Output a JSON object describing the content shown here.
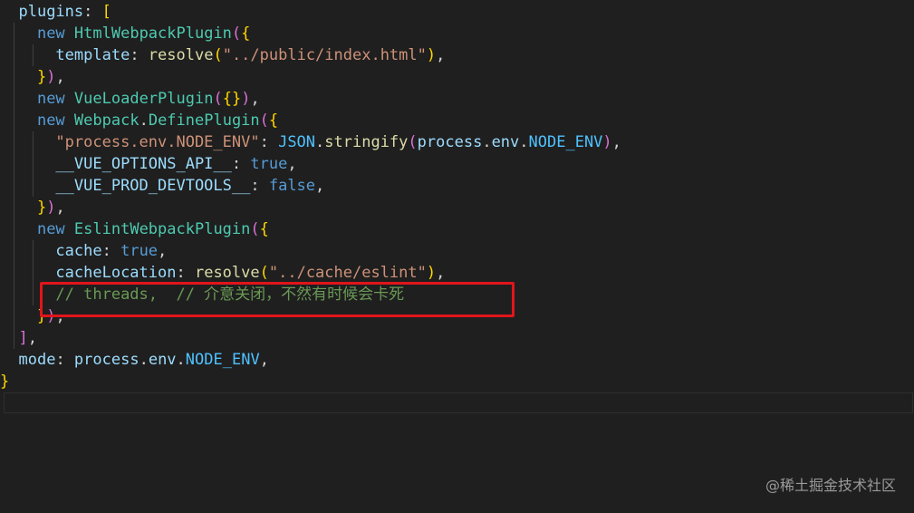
{
  "editor": {
    "colors": {
      "background": "#1f1f1f",
      "keyword": "#569cd6",
      "class": "#4ec9b0",
      "function": "#dcdcaa",
      "string": "#ce9178",
      "property": "#9cdcfe",
      "constant": "#4fc1ff",
      "comment": "#6a9955",
      "highlight_box": "#e0151a"
    },
    "lines": [
      {
        "tokens": [
          {
            "t": "  "
          },
          {
            "t": "plugins",
            "c": "prop"
          },
          {
            "t": ": "
          },
          {
            "t": "[",
            "c": "b1"
          }
        ]
      },
      {
        "tokens": [
          {
            "t": "    "
          },
          {
            "t": "new",
            "c": "kw"
          },
          {
            "t": " "
          },
          {
            "t": "HtmlWebpackPlugin",
            "c": "cls"
          },
          {
            "t": "(",
            "c": "b2"
          },
          {
            "t": "{",
            "c": "b1"
          }
        ]
      },
      {
        "tokens": [
          {
            "t": "      "
          },
          {
            "t": "template",
            "c": "prop"
          },
          {
            "t": ": "
          },
          {
            "t": "resolve",
            "c": "fn"
          },
          {
            "t": "(",
            "c": "b1"
          },
          {
            "t": "\"../public/index.html\"",
            "c": "str"
          },
          {
            "t": ")",
            "c": "b1"
          },
          {
            "t": ","
          }
        ]
      },
      {
        "tokens": [
          {
            "t": "    "
          },
          {
            "t": "}",
            "c": "b1"
          },
          {
            "t": ")",
            "c": "b2"
          },
          {
            "t": ","
          }
        ]
      },
      {
        "tokens": [
          {
            "t": "    "
          },
          {
            "t": "new",
            "c": "kw"
          },
          {
            "t": " "
          },
          {
            "t": "VueLoaderPlugin",
            "c": "cls"
          },
          {
            "t": "(",
            "c": "b2"
          },
          {
            "t": "{}",
            "c": "b1"
          },
          {
            "t": ")",
            "c": "b2"
          },
          {
            "t": ","
          }
        ]
      },
      {
        "tokens": [
          {
            "t": "    "
          },
          {
            "t": "new",
            "c": "kw"
          },
          {
            "t": " "
          },
          {
            "t": "Webpack",
            "c": "cls"
          },
          {
            "t": "."
          },
          {
            "t": "DefinePlugin",
            "c": "cls"
          },
          {
            "t": "(",
            "c": "b2"
          },
          {
            "t": "{",
            "c": "b1"
          }
        ]
      },
      {
        "tokens": [
          {
            "t": "      "
          },
          {
            "t": "\"process.env.NODE_ENV\"",
            "c": "str"
          },
          {
            "t": ": "
          },
          {
            "t": "JSON",
            "c": "const"
          },
          {
            "t": "."
          },
          {
            "t": "stringify",
            "c": "fn"
          },
          {
            "t": "(",
            "c": "b2"
          },
          {
            "t": "process",
            "c": "prop"
          },
          {
            "t": "."
          },
          {
            "t": "env",
            "c": "prop"
          },
          {
            "t": "."
          },
          {
            "t": "NODE_ENV",
            "c": "const"
          },
          {
            "t": ")",
            "c": "b2"
          },
          {
            "t": ","
          }
        ]
      },
      {
        "tokens": [
          {
            "t": "      "
          },
          {
            "t": "__VUE_OPTIONS_API__",
            "c": "prop"
          },
          {
            "t": ": "
          },
          {
            "t": "true",
            "c": "kw"
          },
          {
            "t": ","
          }
        ]
      },
      {
        "tokens": [
          {
            "t": "      "
          },
          {
            "t": "__VUE_PROD_DEVTOOLS__",
            "c": "prop"
          },
          {
            "t": ": "
          },
          {
            "t": "false",
            "c": "kw"
          },
          {
            "t": ","
          }
        ]
      },
      {
        "tokens": [
          {
            "t": "    "
          },
          {
            "t": "}",
            "c": "b1"
          },
          {
            "t": ")",
            "c": "b2"
          },
          {
            "t": ","
          }
        ]
      },
      {
        "tokens": [
          {
            "t": "    "
          },
          {
            "t": "new",
            "c": "kw"
          },
          {
            "t": " "
          },
          {
            "t": "EslintWebpackPlugin",
            "c": "cls"
          },
          {
            "t": "(",
            "c": "b2"
          },
          {
            "t": "{",
            "c": "b1"
          }
        ]
      },
      {
        "tokens": [
          {
            "t": "      "
          },
          {
            "t": "cache",
            "c": "prop"
          },
          {
            "t": ": "
          },
          {
            "t": "true",
            "c": "kw"
          },
          {
            "t": ","
          }
        ]
      },
      {
        "tokens": [
          {
            "t": "      "
          },
          {
            "t": "cacheLocation",
            "c": "prop"
          },
          {
            "t": ": "
          },
          {
            "t": "resolve",
            "c": "fn"
          },
          {
            "t": "(",
            "c": "b1"
          },
          {
            "t": "\"../cache/eslint\"",
            "c": "str"
          },
          {
            "t": ")",
            "c": "b1"
          },
          {
            "t": ","
          }
        ]
      },
      {
        "tokens": [
          {
            "t": "      "
          },
          {
            "t": "// threads,  // 介意关闭，不然有时候会卡死",
            "c": "cmt"
          }
        ]
      },
      {
        "tokens": [
          {
            "t": "    "
          },
          {
            "t": "}",
            "c": "b1"
          },
          {
            "t": ")",
            "c": "b2"
          },
          {
            "t": ","
          }
        ]
      },
      {
        "tokens": [
          {
            "t": "  "
          },
          {
            "t": "]",
            "c": "b2"
          },
          {
            "t": ","
          }
        ]
      },
      {
        "tokens": [
          {
            "t": "  "
          },
          {
            "t": "mode",
            "c": "prop"
          },
          {
            "t": ": "
          },
          {
            "t": "process",
            "c": "prop"
          },
          {
            "t": "."
          },
          {
            "t": "env",
            "c": "prop"
          },
          {
            "t": "."
          },
          {
            "t": "NODE_ENV",
            "c": "const"
          },
          {
            "t": ","
          }
        ]
      },
      {
        "tokens": [
          {
            "t": "}",
            "c": "b1"
          }
        ]
      },
      {
        "tokens": [
          {
            "t": ""
          }
        ]
      }
    ]
  },
  "watermark": "@稀土掘金技术社区"
}
